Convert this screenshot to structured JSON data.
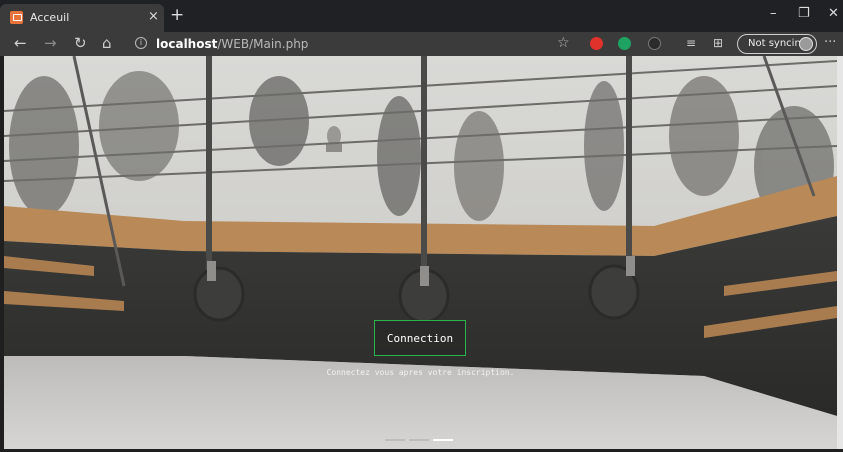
{
  "browser": {
    "tab_title": "Acceuil",
    "tab_close": "×",
    "new_tab": "+",
    "url_host": "localhost",
    "url_path": "/WEB/Main.php",
    "sync_label": "Not syncing",
    "window_controls": {
      "minimize": "–",
      "restore": "❐",
      "close": "✕"
    },
    "nav": {
      "back": "←",
      "forward": "→",
      "refresh": "↻",
      "home": "⌂",
      "info": "i",
      "favorite": "☆",
      "favorites": "≡",
      "collections": "⊞",
      "more": "···"
    },
    "extensions": [
      {
        "name": "red-extension-icon",
        "color": "#e0312b"
      },
      {
        "name": "green-extension-icon",
        "color": "#1ea362"
      },
      {
        "name": "grey-extension-icon",
        "color": "#6b6b6b"
      }
    ]
  },
  "hero": {
    "button_label": "Connection",
    "subtitle": "Connectez vous apres votre inscription.",
    "slides": 3,
    "active_slide": 3,
    "accent": "#2ab54a"
  }
}
